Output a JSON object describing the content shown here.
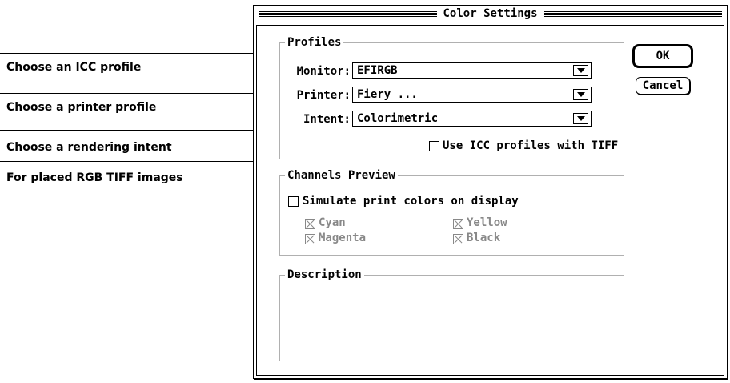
{
  "callouts": [
    "Choose an ICC profile",
    "Choose a printer profile",
    "Choose a rendering intent",
    "For placed RGB TIFF images"
  ],
  "dialog": {
    "title": "Color Settings",
    "profiles": {
      "group_label": "Profiles",
      "monitor_label": "Monitor:",
      "monitor_value": "EFIRGB",
      "printer_label": "Printer:",
      "printer_value": "Fiery ...",
      "intent_label": "Intent:",
      "intent_value": "Colorimetric",
      "tiff_checkbox_label": "Use ICC profiles with TIFF",
      "tiff_checked": false
    },
    "channels": {
      "group_label": "Channels Preview",
      "simulate_label": "Simulate print colors on display",
      "simulate_checked": false,
      "cyan_label": "Cyan",
      "yellow_label": "Yellow",
      "magenta_label": "Magenta",
      "black_label": "Black"
    },
    "description": {
      "group_label": "Description"
    },
    "buttons": {
      "ok": "OK",
      "cancel": "Cancel"
    }
  }
}
